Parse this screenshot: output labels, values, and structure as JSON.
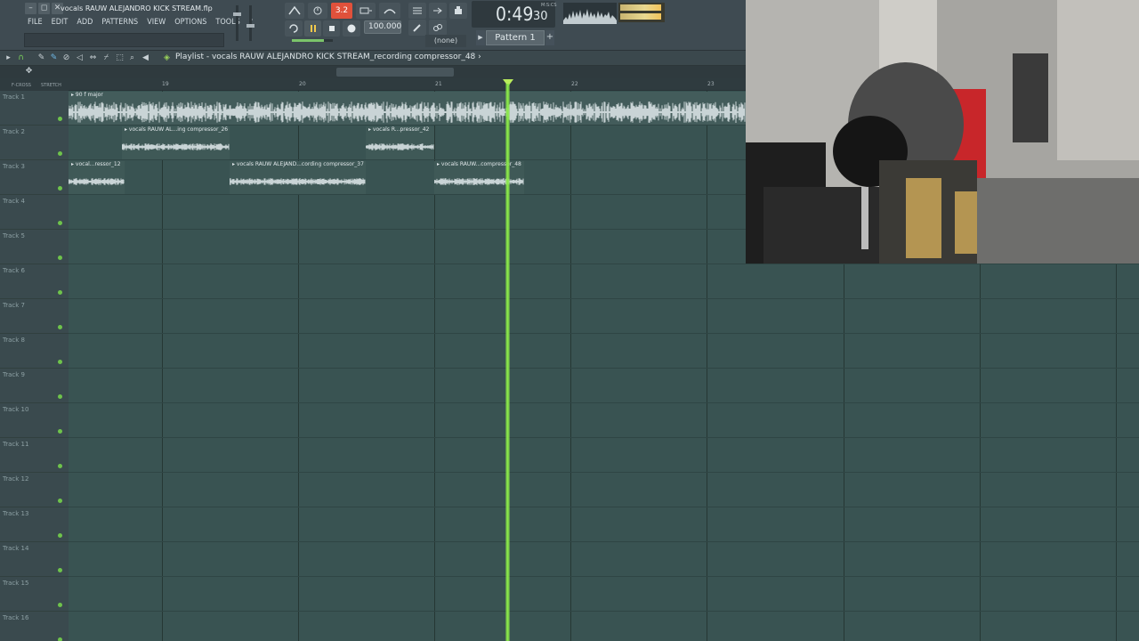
{
  "window": {
    "file_title": "vocals RAUW ALEJANDRO KICK STREAM.flp",
    "buttons": [
      "–",
      "◻",
      "✕"
    ]
  },
  "menu": {
    "items": [
      "FILE",
      "EDIT",
      "ADD",
      "PATTERNS",
      "VIEW",
      "OPTIONS",
      "TOOLS",
      "?"
    ]
  },
  "transport": {
    "time_main": "0:49",
    "time_sub": "30",
    "time_unit": "M:S:CS",
    "tempo": "100.000",
    "snap": "(none)",
    "pattern": "Pattern 1",
    "pattern_add": "+",
    "pattern_prev": "▶",
    "counter_label": "3.2"
  },
  "playlist": {
    "title": "Playlist - vocals RAUW ALEJANDRO KICK STREAM_recording compressor_48",
    "title_arrow": "›",
    "ruler_left_labels": [
      "F-CROSS",
      "STRETCH"
    ],
    "bar_numbers": [
      "19",
      "20",
      "21",
      "22",
      "23"
    ],
    "playhead_position_bars": 21.52,
    "tracks": [
      {
        "name": "Track 1"
      },
      {
        "name": "Track 2"
      },
      {
        "name": "Track 3"
      },
      {
        "name": "Track 4"
      },
      {
        "name": "Track 5"
      },
      {
        "name": "Track 6"
      },
      {
        "name": "Track 7"
      },
      {
        "name": "Track 8"
      },
      {
        "name": "Track 9"
      },
      {
        "name": "Track 10"
      },
      {
        "name": "Track 11"
      },
      {
        "name": "Track 12"
      },
      {
        "name": "Track 13"
      },
      {
        "name": "Track 14"
      },
      {
        "name": "Track 15"
      },
      {
        "name": "Track 16"
      }
    ],
    "clips": {
      "track1": {
        "label": "▸ 90 f major"
      },
      "track2_a": {
        "label": "▸ vocals RAUW AL...ing compressor_26"
      },
      "track2_b": {
        "label": "▸ vocals R...pressor_42"
      },
      "track3_a": {
        "label": "▸ vocal...ressor_12"
      },
      "track3_b": {
        "label": "▸ vocals RAUW ALEJAND...cording compressor_37"
      },
      "track3_c": {
        "label": "▸ vocals RAUW...compressor_48"
      }
    }
  },
  "colors": {
    "grid_bg": "#395352",
    "playhead": "#8ae84a",
    "track_led": "#6ec34b",
    "rec_button": "#e0513b"
  }
}
